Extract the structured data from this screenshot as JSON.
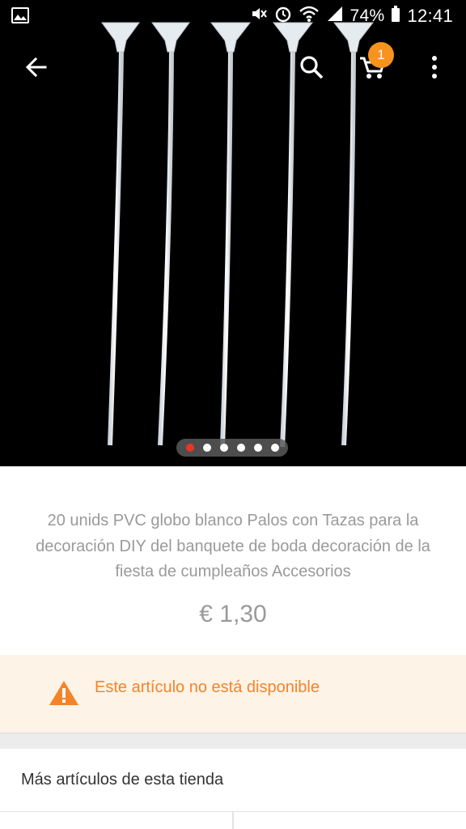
{
  "status_bar": {
    "battery_percent": "74%",
    "time": "12:41",
    "icons": [
      "image-notification-icon",
      "mute-icon",
      "alarm-icon",
      "wifi-icon",
      "signal-icon",
      "battery-icon"
    ]
  },
  "toolbar": {
    "back_icon": "arrow-left-icon",
    "search_icon": "search-icon",
    "cart_icon": "cart-icon",
    "cart_count": "1",
    "more_icon": "more-vert-icon"
  },
  "gallery": {
    "image_count": 6,
    "active_index": 0
  },
  "product": {
    "title": "20 unids PVC globo blanco Palos con Tazas para la decoración DIY del banquete de boda decoración de la fiesta de cumpleaños Accesorios",
    "price": "€ 1,30"
  },
  "availability": {
    "warning_icon": "warning-icon",
    "message": "Este artículo no está disponible"
  },
  "store": {
    "heading": "Más artículos de esta tienda"
  },
  "colors": {
    "accent": "#f7931e",
    "warning_text": "#f4842a",
    "warning_bg": "#fdf3e6",
    "active_dot": "#e8352a"
  }
}
